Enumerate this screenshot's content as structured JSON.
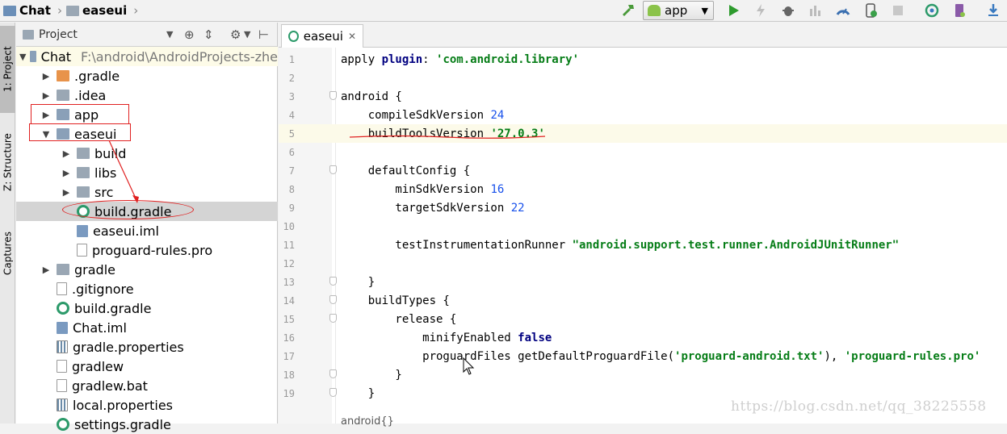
{
  "breadcrumb": {
    "root": "Chat",
    "child": "easeui"
  },
  "toolbar": {
    "run_config": "app"
  },
  "side_tabs": {
    "project": "1: Project",
    "structure": "Z: Structure",
    "captures": "Captures"
  },
  "project_panel": {
    "view_mode": "Project",
    "tree": [
      {
        "label": "Chat",
        "path": "F:\\android\\AndroidProjects-zhe",
        "icon": "module-folder-icon",
        "arrow": "down",
        "level": 0
      },
      {
        "label": ".gradle",
        "icon": "folder-orange-icon",
        "arrow": "right",
        "level": 1
      },
      {
        "label": ".idea",
        "icon": "folder-icon",
        "arrow": "right",
        "level": 1
      },
      {
        "label": "app",
        "icon": "android-module-icon",
        "arrow": "right",
        "level": 1
      },
      {
        "label": "easeui",
        "icon": "library-module-icon",
        "arrow": "down",
        "level": 1
      },
      {
        "label": "build",
        "icon": "folder-icon",
        "arrow": "right",
        "level": 2
      },
      {
        "label": "libs",
        "icon": "folder-icon",
        "arrow": "right",
        "level": 2
      },
      {
        "label": "src",
        "icon": "folder-icon",
        "arrow": "right",
        "level": 2
      },
      {
        "label": "build.gradle",
        "icon": "gradle-icon",
        "arrow": "",
        "level": 2
      },
      {
        "label": "easeui.iml",
        "icon": "iml-icon",
        "arrow": "",
        "level": 2
      },
      {
        "label": "proguard-rules.pro",
        "icon": "file-icon",
        "arrow": "",
        "level": 2
      },
      {
        "label": "gradle",
        "icon": "folder-icon",
        "arrow": "right",
        "level": 1
      },
      {
        "label": ".gitignore",
        "icon": "file-icon",
        "arrow": "",
        "level": 1
      },
      {
        "label": "build.gradle",
        "icon": "gradle-icon",
        "arrow": "",
        "level": 1
      },
      {
        "label": "Chat.iml",
        "icon": "iml-icon",
        "arrow": "",
        "level": 1
      },
      {
        "label": "gradle.properties",
        "icon": "properties-icon",
        "arrow": "",
        "level": 1
      },
      {
        "label": "gradlew",
        "icon": "file-icon",
        "arrow": "",
        "level": 1
      },
      {
        "label": "gradlew.bat",
        "icon": "file-icon",
        "arrow": "",
        "level": 1
      },
      {
        "label": "local.properties",
        "icon": "properties-icon",
        "arrow": "",
        "level": 1
      },
      {
        "label": "settings.gradle",
        "icon": "gradle-icon",
        "arrow": "",
        "level": 1
      }
    ]
  },
  "editor": {
    "tab_label": "easeui",
    "lines": [
      {
        "n": "1",
        "text": "apply plugin: 'com.android.library'"
      },
      {
        "n": "2",
        "text": ""
      },
      {
        "n": "3",
        "text": "android {"
      },
      {
        "n": "4",
        "text": "    compileSdkVersion 24"
      },
      {
        "n": "5",
        "text": "    buildToolsVersion '27.0.3'"
      },
      {
        "n": "6",
        "text": ""
      },
      {
        "n": "7",
        "text": "    defaultConfig {"
      },
      {
        "n": "8",
        "text": "        minSdkVersion 16"
      },
      {
        "n": "9",
        "text": "        targetSdkVersion 22"
      },
      {
        "n": "10",
        "text": ""
      },
      {
        "n": "11",
        "text": "        testInstrumentationRunner \"android.support.test.runner.AndroidJUnitRunner\""
      },
      {
        "n": "12",
        "text": ""
      },
      {
        "n": "13",
        "text": "    }"
      },
      {
        "n": "14",
        "text": "    buildTypes {"
      },
      {
        "n": "15",
        "text": "        release {"
      },
      {
        "n": "16",
        "text": "            minifyEnabled false"
      },
      {
        "n": "17",
        "text": "            proguardFiles getDefaultProguardFile('proguard-android.txt'), 'proguard-rules.pro'"
      },
      {
        "n": "18",
        "text": "        }"
      },
      {
        "n": "19",
        "text": "    }"
      }
    ],
    "breadcrumb": "android{}"
  },
  "watermark": "https://blog.csdn.net/qq_38225558",
  "colors": {
    "annotation_red": "#e02020",
    "string_green": "#067d17",
    "number_blue": "#1750eb",
    "keyword_navy": "#000080"
  }
}
